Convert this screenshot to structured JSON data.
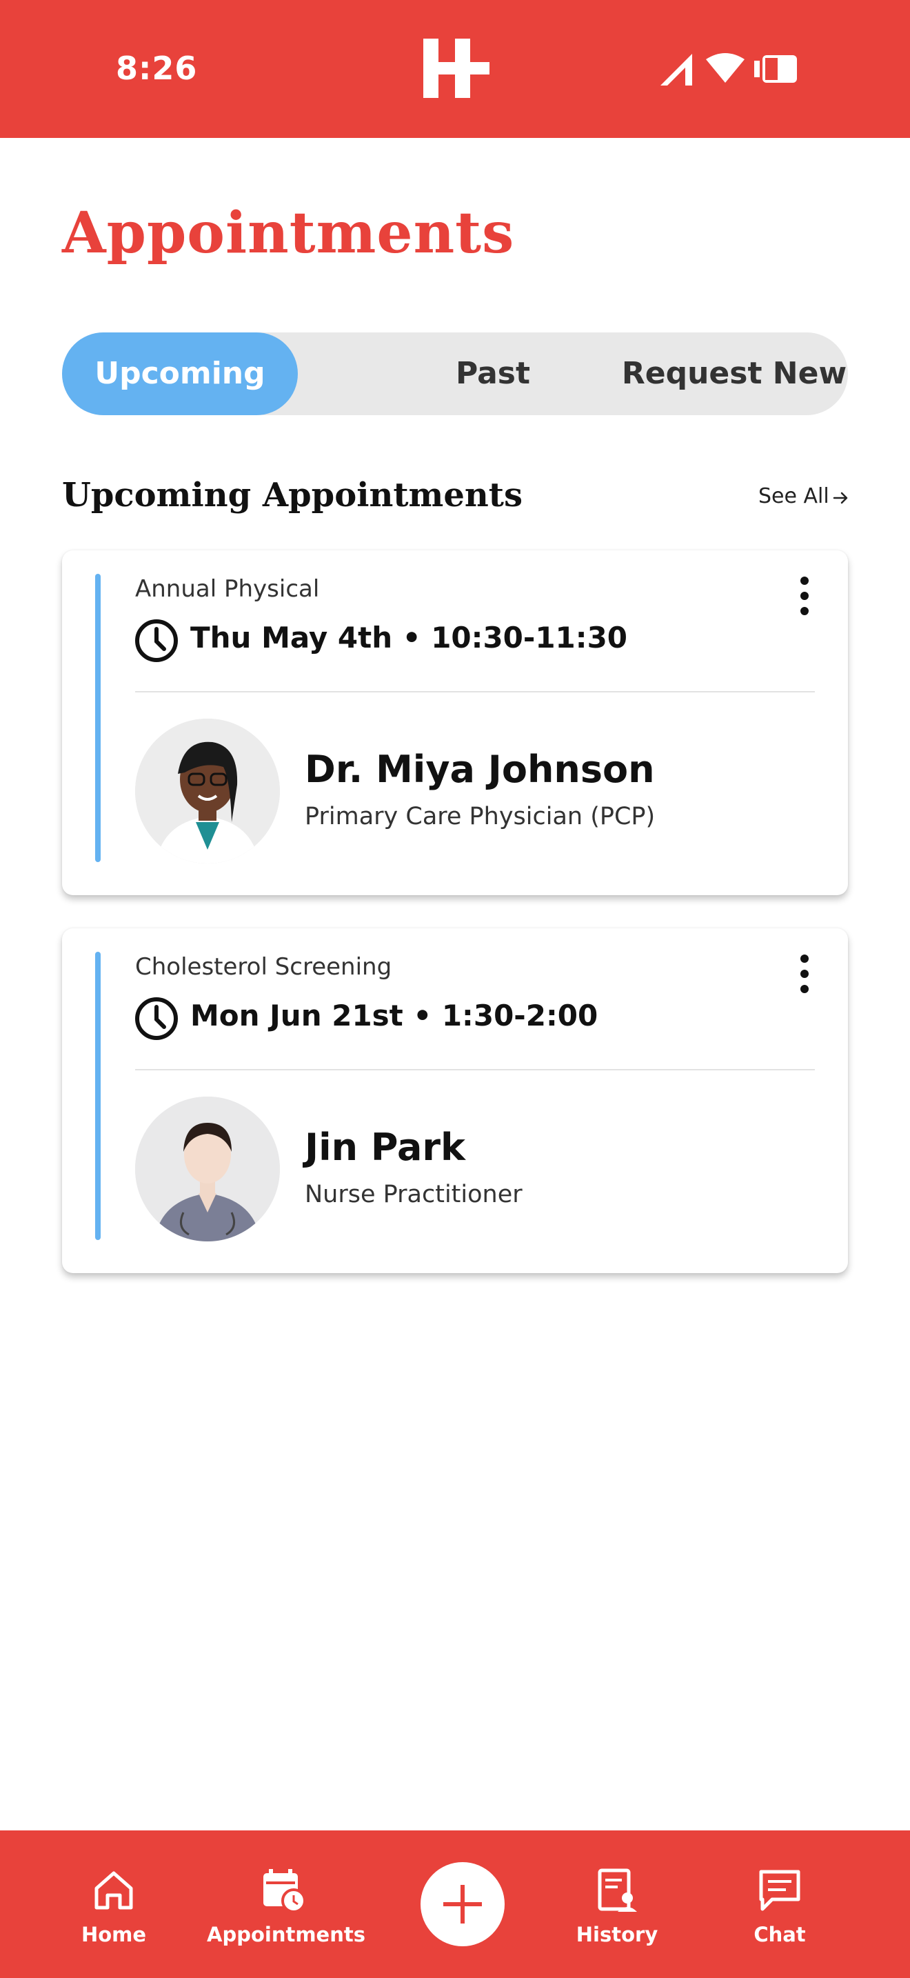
{
  "status_bar": {
    "time": "8:26",
    "icons": [
      "cell-signal-icon",
      "wifi-icon",
      "battery-icon"
    ],
    "logo": "hospital-h-plus-logo"
  },
  "page": {
    "title": "Appointments"
  },
  "tabs": [
    {
      "label": "Upcoming",
      "active": true
    },
    {
      "label": "Past",
      "active": false
    },
    {
      "label": "Request New",
      "active": false
    }
  ],
  "section": {
    "title": "Upcoming Appointments",
    "see_all": "See All"
  },
  "appointments": [
    {
      "type": "Annual Physical",
      "datetime": "Thu May 4th • 10:30-11:30",
      "provider_name": "Dr. Miya Johnson",
      "provider_role": "Primary Care Physician (PCP)"
    },
    {
      "type": "Cholesterol Screening",
      "datetime": "Mon Jun 21st • 1:30-2:00",
      "provider_name": "Jin Park",
      "provider_role": "Nurse Practitioner"
    }
  ],
  "nav": {
    "home": "Home",
    "appointments": "Appointments",
    "history": "History",
    "chat": "Chat"
  },
  "colors": {
    "brand_red": "#e8423b",
    "accent_blue": "#64b2f1",
    "segment_bg": "#e8e8e8"
  }
}
